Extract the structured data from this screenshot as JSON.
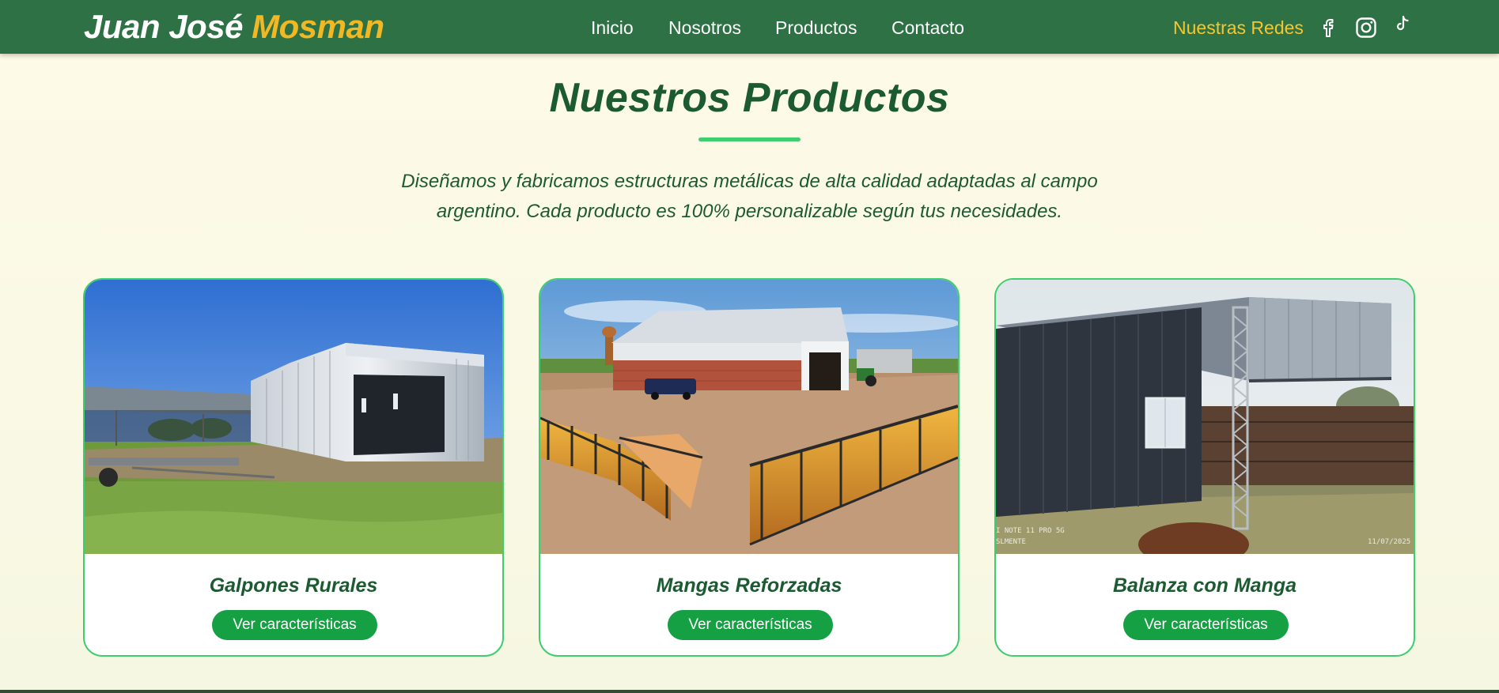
{
  "header": {
    "brand_first": "Juan José",
    "brand_last": "Mosman",
    "nav": [
      "Inicio",
      "Nosotros",
      "Productos",
      "Contacto"
    ],
    "social_label": "Nuestras Redes",
    "social_icons": [
      "facebook-icon",
      "instagram-icon",
      "tiktok-icon"
    ]
  },
  "section": {
    "title": "Nuestros Productos",
    "subtitle_line1": "Diseñamos y fabricamos estructuras metálicas de alta calidad adaptadas al campo",
    "subtitle_line2": "argentino. Cada producto es 100% personalizable según tus necesidades."
  },
  "products": [
    {
      "title": "Galpones Rurales",
      "button": "Ver características"
    },
    {
      "title": "Mangas Reforzadas",
      "button": "Ver características"
    },
    {
      "title": "Balanza con Manga",
      "button": "Ver características"
    }
  ],
  "photo_overlay": {
    "device_line1": "I NOTE 11 PRO 5G",
    "device_line2": "SLMENTE",
    "date": "11/07/2025"
  },
  "colors": {
    "header_bg": "#2e7145",
    "brand_accent": "#f2b824",
    "title_green": "#1c5a31",
    "card_border": "#3fce6e",
    "button_bg": "#16a044"
  }
}
